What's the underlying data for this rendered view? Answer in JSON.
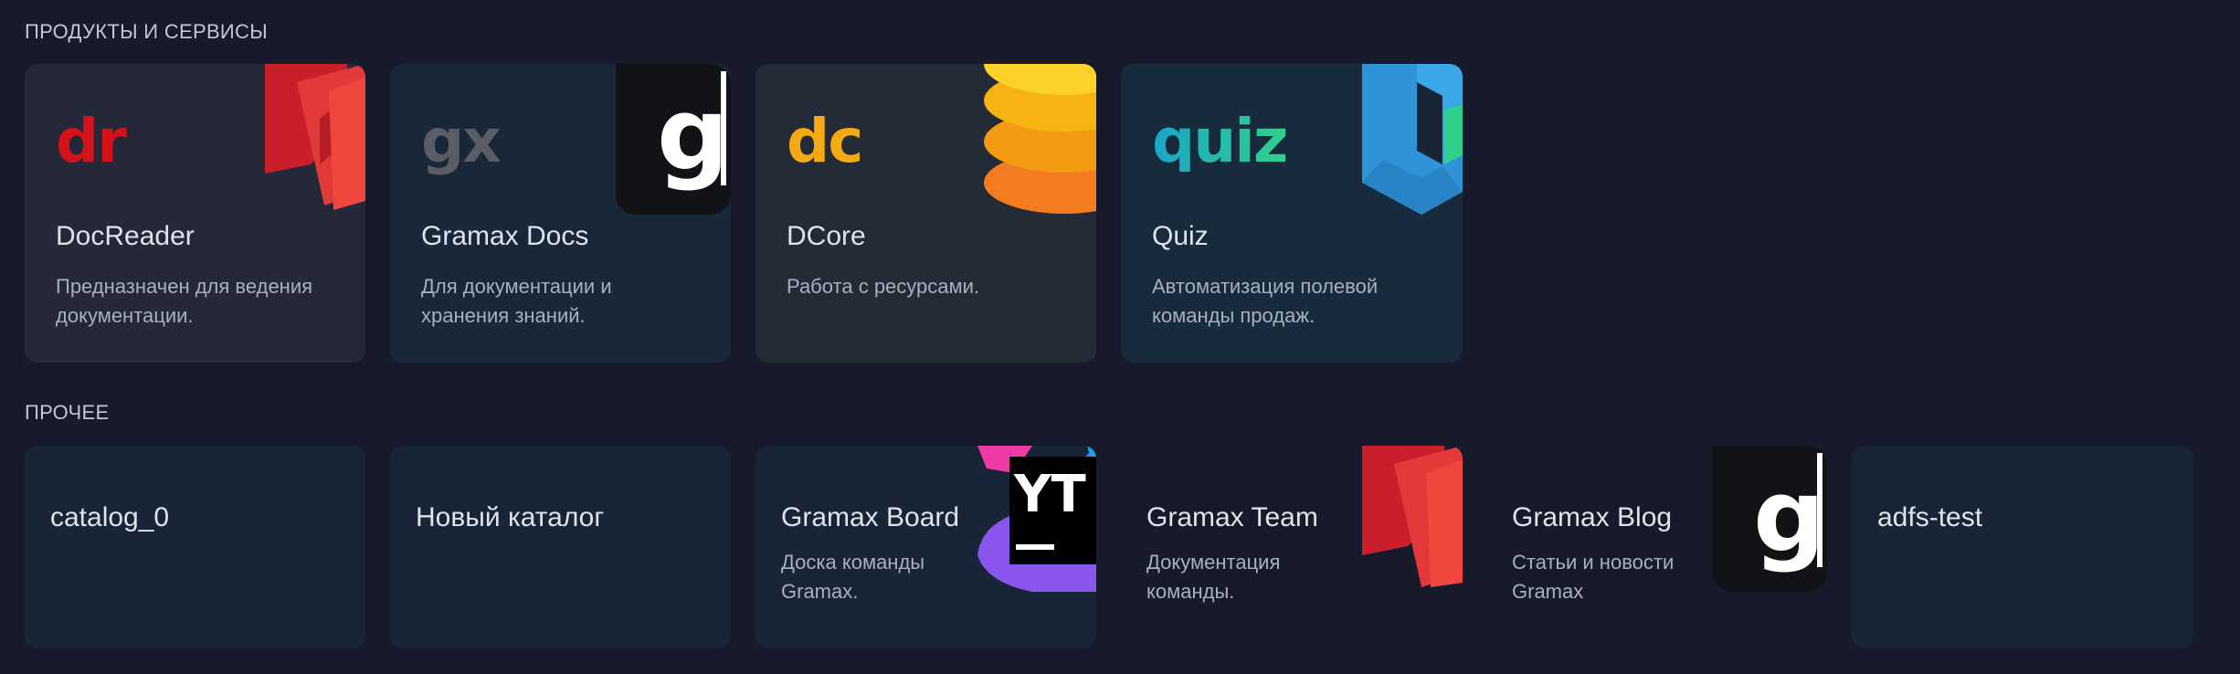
{
  "sections": {
    "products": {
      "title": "ПРОДУКТЫ И СЕРВИСЫ",
      "cards": [
        {
          "logo": "dr",
          "title": "DocReader",
          "desc": "Предназначен для ведения документации.",
          "icon": "docreader-logo-icon",
          "logo_color": "#d4121a"
        },
        {
          "logo": "gx",
          "title": "Gramax Docs",
          "desc": "Для документации и хранения знаний.",
          "icon": "gramax-logo-icon",
          "logo_color": "#5a5d66"
        },
        {
          "logo": "dc",
          "title": "DCore",
          "desc": "Работа с ресурсами.",
          "icon": "dcore-logo-icon",
          "logo_color": "#f5a913"
        },
        {
          "logo": "quiz",
          "title": "Quiz",
          "desc": "Автоматизация полевой команды продаж.",
          "icon": "quiz-logo-icon",
          "logo_color": "#1aa5c9"
        }
      ]
    },
    "other": {
      "title": "ПРОЧЕЕ",
      "cards": [
        {
          "title": "catalog_0",
          "desc": ""
        },
        {
          "title": "Новый каталог",
          "desc": ""
        },
        {
          "title": "Gramax Board",
          "desc": "Доска команды Gramax.",
          "icon": "youtrack-logo-icon"
        },
        {
          "title": "Gramax Team",
          "desc": "Документация команды.",
          "icon": "docreader-logo-icon"
        },
        {
          "title": "Gramax Blog",
          "desc": "Статьи и новости Gramax",
          "icon": "gramax-logo-icon"
        },
        {
          "title": "adfs-test",
          "desc": ""
        }
      ]
    }
  },
  "colors": {
    "background": "#161a2b",
    "card": "#172536",
    "docreader_red": "#e8343a",
    "dcore_orange": "#f5a913",
    "quiz_blue": "#3aa7e6",
    "quiz_green": "#2fd18a"
  }
}
